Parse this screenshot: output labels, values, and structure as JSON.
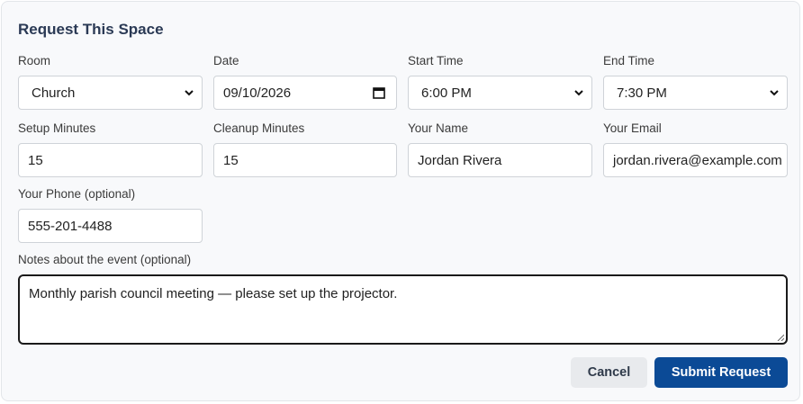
{
  "form": {
    "title": "Request This Space",
    "room": {
      "label": "Room",
      "value": "Church"
    },
    "date": {
      "label": "Date",
      "value": "09/10/2026"
    },
    "start_time": {
      "label": "Start Time",
      "value": "6:00 PM"
    },
    "end_time": {
      "label": "End Time",
      "value": "7:30 PM"
    },
    "setup_minutes": {
      "label": "Setup Minutes",
      "value": "15"
    },
    "cleanup_minutes": {
      "label": "Cleanup Minutes",
      "value": "15"
    },
    "your_name": {
      "label": "Your Name",
      "value": "Jordan Rivera"
    },
    "your_email": {
      "label": "Your Email",
      "value": "jordan.rivera@example.com"
    },
    "your_phone": {
      "label": "Your Phone (optional)",
      "value": "555-201-4488"
    },
    "notes": {
      "label": "Notes about the event (optional)",
      "value": "Monthly parish council meeting — please set up the projector."
    }
  },
  "actions": {
    "cancel_label": "Cancel",
    "submit_label": "Submit Request"
  },
  "colors": {
    "title": "#2b3a55",
    "submit_bg": "#0b4a96",
    "cancel_bg": "#e8eaed",
    "panel_bg": "#f8f9fb"
  },
  "icons": {
    "select": "chevron-down-icon",
    "date": "calendar-icon",
    "textarea": "resize-handle-icon"
  }
}
